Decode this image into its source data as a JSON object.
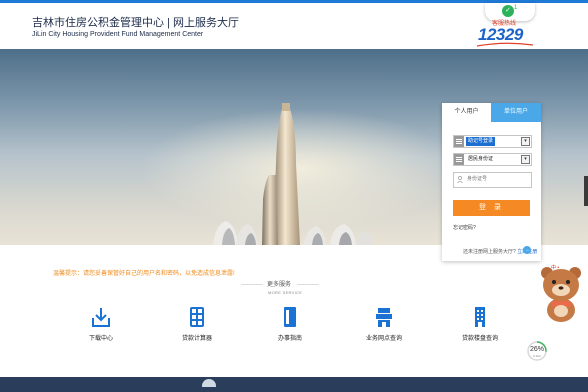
{
  "header": {
    "title": "吉林市住房公积金管理中心 | 网上服务大厅",
    "subtitle": "JiLin City Housing Provident Fund Management Center",
    "badge_count": "1",
    "hotline_caption": "客服热线",
    "hotline_number": "12329"
  },
  "login": {
    "tabs": [
      "个人用户",
      "单位用户"
    ],
    "login_type": "助记号登录",
    "id_type": "居民身份证",
    "id_placeholder": "身份证号",
    "login_button": "登 录",
    "forgot_password": "忘记密码?",
    "new_user_text": "还未注册网上服务大厅?",
    "new_user_link": "立即注册",
    "go_icon": "→"
  },
  "notice": "温馨提示：请您妥善保管好自己的用户名和密码，以免造成信息泄露!",
  "more_service": {
    "title": "更多服务",
    "subtitle": "MORE SERVICE"
  },
  "services": [
    {
      "label": "下载中心",
      "icon": "download-icon"
    },
    {
      "label": "贷款计算器",
      "icon": "calculator-icon"
    },
    {
      "label": "办事指南",
      "icon": "guide-book-icon"
    },
    {
      "label": "业务网点查询",
      "icon": "outlet-query-icon"
    },
    {
      "label": "贷款楼盘查询",
      "icon": "building-query-icon"
    }
  ],
  "progress_widget": {
    "percent": "26%",
    "value": 26,
    "sub": "0.1k/s"
  },
  "colors": {
    "primary_blue": "#1f7ad6",
    "unit_tab_blue": "#4aa8e8",
    "login_orange": "#f58a25",
    "notice_orange": "#f08a1a",
    "footer": "#2a3d5a"
  }
}
